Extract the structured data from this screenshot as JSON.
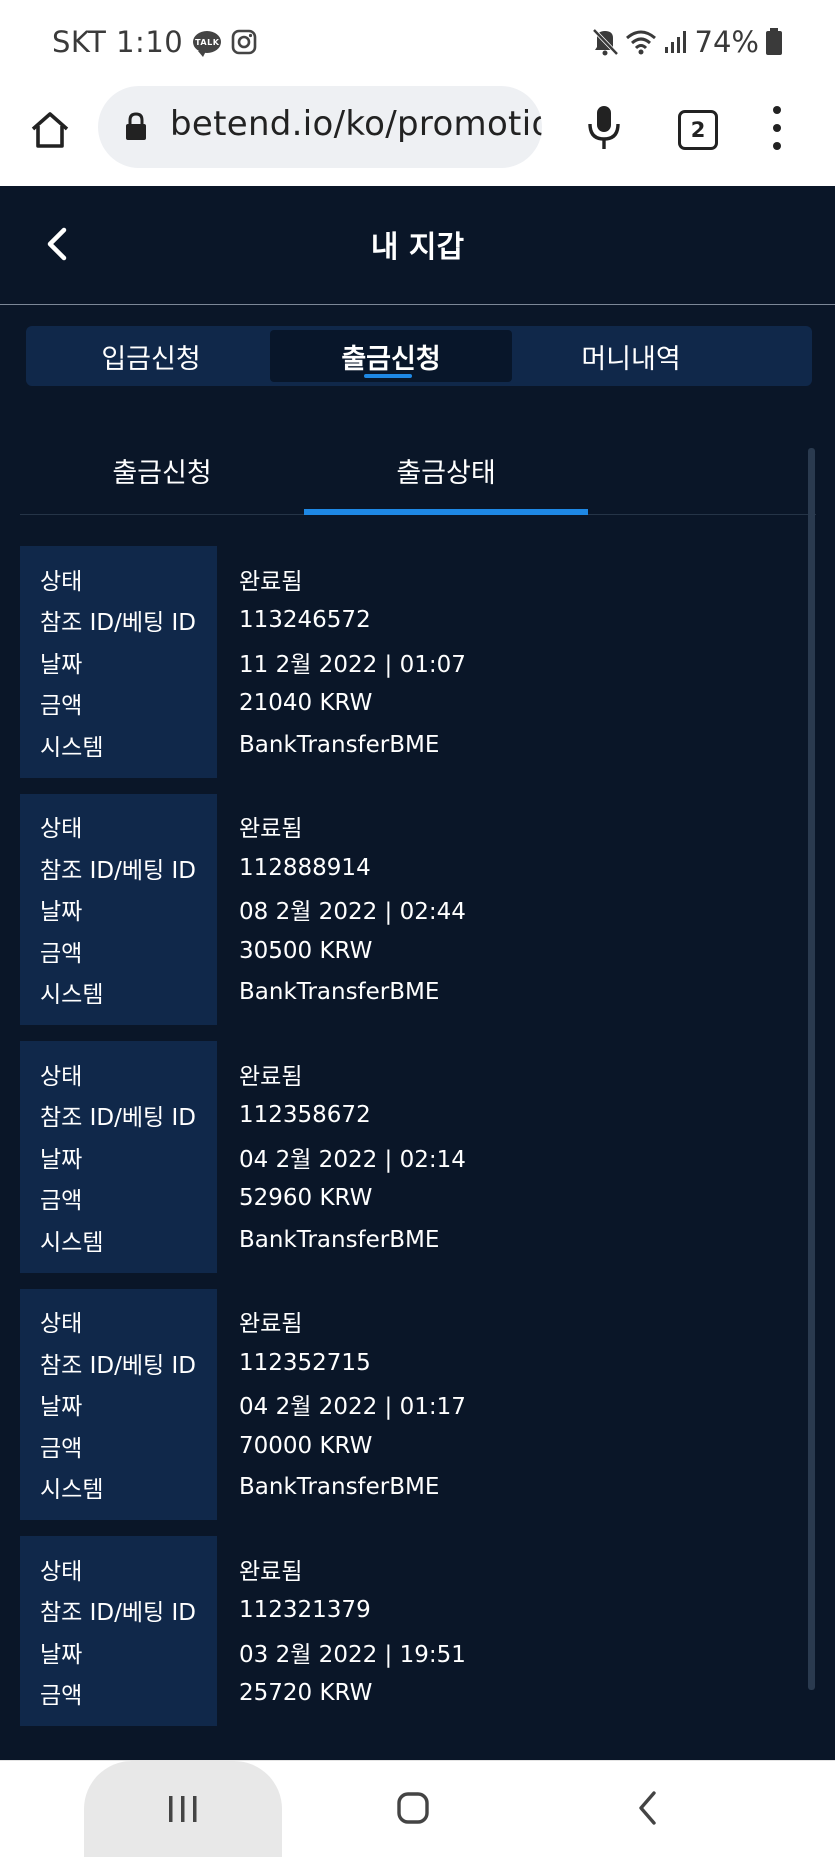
{
  "status_bar": {
    "carrier_time": "SKT 1:10",
    "talk_icon_text": "TALK",
    "battery": "74%"
  },
  "browser": {
    "url": "betend.io/ko/promotio",
    "tab_count": "2"
  },
  "wallet": {
    "title": "내 지갑",
    "main_tabs": [
      {
        "label": "입금신청",
        "active": false
      },
      {
        "label": "출금신청",
        "active": true
      },
      {
        "label": "머니내역",
        "active": false
      }
    ],
    "sub_tabs": [
      {
        "label": "출금신청",
        "active": false
      },
      {
        "label": "출금상태",
        "active": true
      }
    ],
    "labels": {
      "status": "상태",
      "ref_id": "참조 ID/베팅 ID",
      "date": "날짜",
      "amount": "금액",
      "system": "시스템"
    },
    "records": [
      {
        "status": "완료됨",
        "ref_id": "113246572",
        "date": "11 2월 2022 | 01:07",
        "amount": "21040 KRW",
        "system": "BankTransferBME"
      },
      {
        "status": "완료됨",
        "ref_id": "112888914",
        "date": "08 2월 2022 | 02:44",
        "amount": "30500 KRW",
        "system": "BankTransferBME"
      },
      {
        "status": "완료됨",
        "ref_id": "112358672",
        "date": "04 2월 2022 | 02:14",
        "amount": "52960 KRW",
        "system": "BankTransferBME"
      },
      {
        "status": "완료됨",
        "ref_id": "112352715",
        "date": "04 2월 2022 | 01:17",
        "amount": "70000 KRW",
        "system": "BankTransferBME"
      },
      {
        "status": "완료됨",
        "ref_id": "112321379",
        "date": "03 2월 2022 | 19:51",
        "amount": "25720 KRW"
      }
    ]
  },
  "colors": {
    "app_bg": "#0a1628",
    "panel_bg": "#10284a",
    "accent": "#1e88e5",
    "text": "#ffffff"
  },
  "icons": {
    "status_left": [
      "kakaotalk-icon",
      "instagram-icon"
    ],
    "status_right": [
      "mute-icon",
      "wifi-icon",
      "signal-icon",
      "battery-icon"
    ],
    "browser": [
      "home-icon",
      "lock-icon",
      "mic-icon",
      "tab-switcher-icon",
      "more-vert-icon"
    ],
    "nav": [
      "recent-apps-icon",
      "home-icon",
      "back-icon"
    ]
  }
}
